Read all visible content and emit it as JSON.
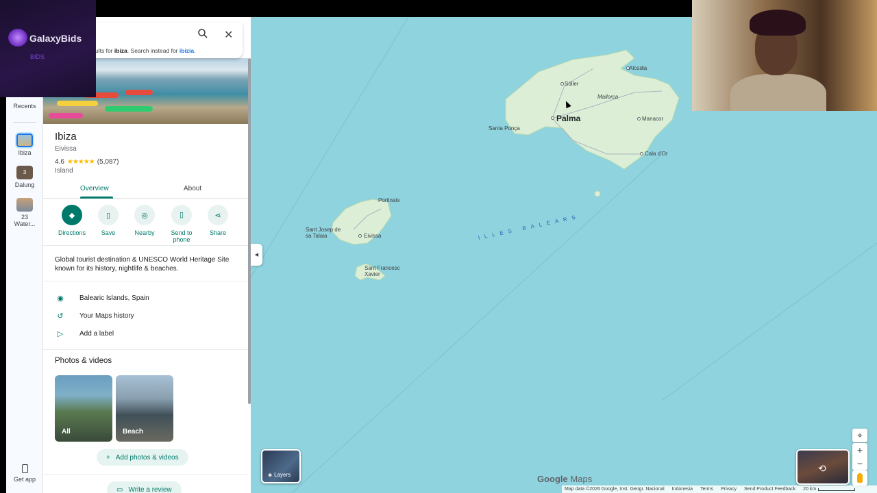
{
  "brand": {
    "name": "GalaxyBids",
    "tag": "BIDS"
  },
  "search": {
    "hint_prefix": "ults for",
    "hint_term": "ibiza",
    "hint_mid": ". Search instead for",
    "hint_link": "ibizia",
    "hint_suffix": "."
  },
  "rail": {
    "recents": "Recents",
    "items": [
      {
        "label": "Ibiza"
      },
      {
        "label": "Dalung",
        "badge": "3"
      },
      {
        "label": "23 Water..."
      }
    ],
    "get_app": "Get app"
  },
  "place": {
    "title": "Ibiza",
    "subtitle": "Eivissa",
    "rating": "4.6",
    "stars": "★★★★★",
    "reviews": "(5,087)",
    "type": "Island",
    "tabs": [
      "Overview",
      "About"
    ],
    "actions": [
      "Directions",
      "Save",
      "Nearby",
      "Send to phone",
      "Share"
    ],
    "description": "Global tourist destination & UNESCO World Heritage Site known for its history, nightlife & beaches.",
    "info": [
      "Balearic Islands, Spain",
      "Your Maps history",
      "Add a label"
    ],
    "photos_title": "Photos & videos",
    "photos": [
      "All",
      "Beach"
    ],
    "add_photos": "Add photos & videos",
    "write_review": "Write a review"
  },
  "map": {
    "labels": {
      "alcudia": "Alcúdia",
      "soller": "Sóller",
      "mallorca": "Mallorca",
      "palma": "Palma",
      "santa_ponca": "Santa Ponça",
      "manacor": "Manacor",
      "cala_dor": "Cala d'Or",
      "portinatx": "Portinatx",
      "sant_josep": "Sant Josep de sa Talaia",
      "eivissa": "Eivissa",
      "sant_francesc": "Sant Francesc Xavier",
      "sea": "ILLES BALEARS"
    },
    "layers": "Layers",
    "google": "Google",
    "maps": "Maps",
    "attribution": "Map data ©2026 Google, Inst. Geogr. Nacional",
    "footer": [
      "Indonesia",
      "Terms",
      "Privacy",
      "Send Product Feedback"
    ],
    "scale": "20 km"
  },
  "colors": {
    "accent": "#00796b",
    "water": "#8fd3de",
    "land": "#dcefd6"
  }
}
